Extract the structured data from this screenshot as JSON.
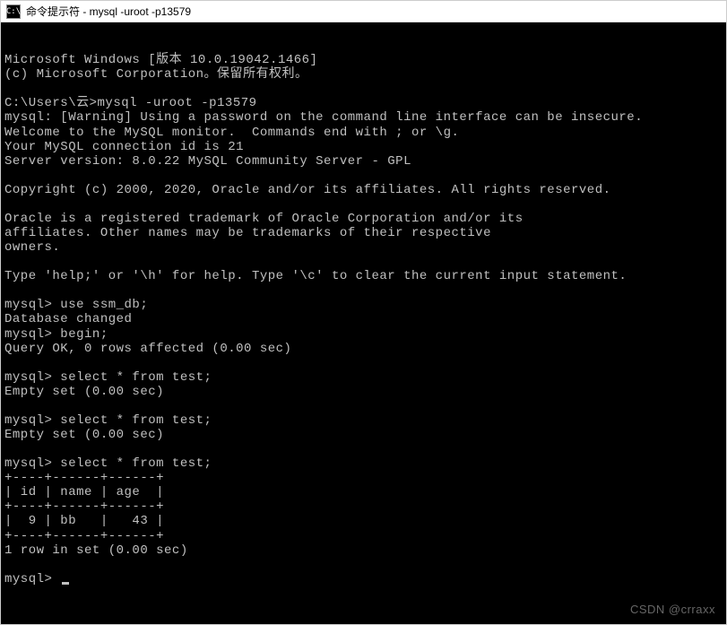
{
  "titlebar": {
    "icon_label": "C:\\",
    "title": "命令提示符 - mysql  -uroot -p13579"
  },
  "terminal": {
    "lines": [
      "Microsoft Windows [版本 10.0.19042.1466]",
      "(c) Microsoft Corporation。保留所有权利。",
      "",
      "C:\\Users\\云>mysql -uroot -p13579",
      "mysql: [Warning] Using a password on the command line interface can be insecure.",
      "Welcome to the MySQL monitor.  Commands end with ; or \\g.",
      "Your MySQL connection id is 21",
      "Server version: 8.0.22 MySQL Community Server - GPL",
      "",
      "Copyright (c) 2000, 2020, Oracle and/or its affiliates. All rights reserved.",
      "",
      "Oracle is a registered trademark of Oracle Corporation and/or its",
      "affiliates. Other names may be trademarks of their respective",
      "owners.",
      "",
      "Type 'help;' or '\\h' for help. Type '\\c' to clear the current input statement.",
      "",
      "mysql> use ssm_db;",
      "Database changed",
      "mysql> begin;",
      "Query OK, 0 rows affected (0.00 sec)",
      "",
      "mysql> select * from test;",
      "Empty set (0.00 sec)",
      "",
      "mysql> select * from test;",
      "Empty set (0.00 sec)",
      "",
      "mysql> select * from test;",
      "+----+------+------+",
      "| id | name | age  |",
      "+----+------+------+",
      "|  9 | bb   |   43 |",
      "+----+------+------+",
      "1 row in set (0.00 sec)",
      "",
      "mysql> "
    ]
  },
  "watermark": "CSDN @crraxx"
}
